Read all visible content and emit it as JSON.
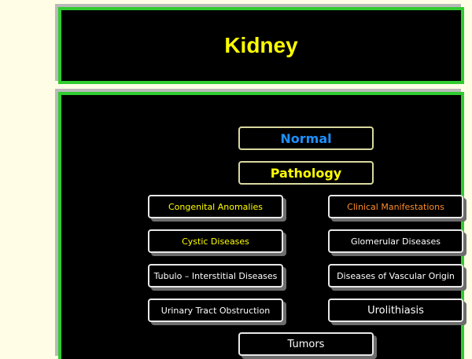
{
  "header": {
    "title": "Kidney"
  },
  "nav": {
    "normal": "Normal",
    "pathology": "Pathology",
    "congenital": "Congenital Anomalies",
    "clinical": "Clinical Manifestations",
    "cystic": "Cystic Diseases",
    "glomerular": "Glomerular Diseases",
    "tubulo": "Tubulo – Interstitial Diseases",
    "vascular": "Diseases of Vascular Origin",
    "urinary": "Urinary Tract Obstruction",
    "urolithiasis": "Urolithiasis",
    "tumors": "Tumors"
  },
  "colors": {
    "panel_border": "#2fcc2f",
    "title": "#ffff00",
    "normal": "#1e90ff",
    "pathology": "#ffff00",
    "clinical": "#ff8c28",
    "page_background": "#fffde6"
  }
}
